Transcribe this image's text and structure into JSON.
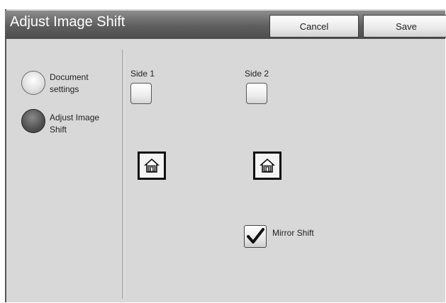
{
  "header": {
    "title": "Adjust Image Shift",
    "cancel_label": "Cancel",
    "save_label": "Save"
  },
  "left_panel": {
    "options": [
      {
        "label": "Document settings",
        "selected": false
      },
      {
        "label": "Adjust Image Shift",
        "selected": true
      }
    ]
  },
  "sides": {
    "side1_label": "Side 1",
    "side2_label": "Side 2"
  },
  "mirror": {
    "label": "Mirror Shift",
    "checked": true
  },
  "icons": {
    "home": "home-icon",
    "check": "check-icon"
  }
}
